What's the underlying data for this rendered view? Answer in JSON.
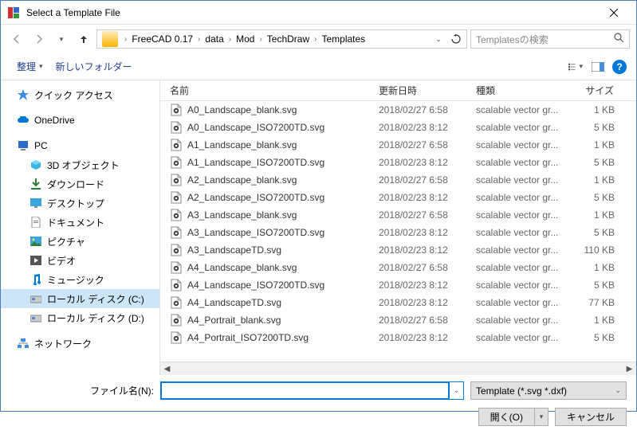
{
  "window": {
    "title": "Select a Template File"
  },
  "breadcrumbs": [
    "FreeCAD 0.17",
    "data",
    "Mod",
    "TechDraw",
    "Templates"
  ],
  "search": {
    "placeholder": "Templatesの検索"
  },
  "toolbar": {
    "organize": "整理",
    "newfolder": "新しいフォルダー"
  },
  "columns": {
    "name": "名前",
    "date": "更新日時",
    "type": "種類",
    "size": "サイズ"
  },
  "sidebar": {
    "quick": "クイック アクセス",
    "onedrive": "OneDrive",
    "pc": "PC",
    "objects3d": "3D オブジェクト",
    "downloads": "ダウンロード",
    "desktop": "デスクトップ",
    "documents": "ドキュメント",
    "pictures": "ピクチャ",
    "videos": "ビデオ",
    "music": "ミュージック",
    "diskc": "ローカル ディスク (C:)",
    "diskd": "ローカル ディスク (D:)",
    "network": "ネットワーク"
  },
  "files": [
    {
      "name": "A0_Landscape_blank.svg",
      "date": "2018/02/27 6:58",
      "type": "scalable vector gr...",
      "size": "1 KB"
    },
    {
      "name": "A0_Landscape_ISO7200TD.svg",
      "date": "2018/02/23 8:12",
      "type": "scalable vector gr...",
      "size": "5 KB"
    },
    {
      "name": "A1_Landscape_blank.svg",
      "date": "2018/02/27 6:58",
      "type": "scalable vector gr...",
      "size": "1 KB"
    },
    {
      "name": "A1_Landscape_ISO7200TD.svg",
      "date": "2018/02/23 8:12",
      "type": "scalable vector gr...",
      "size": "5 KB"
    },
    {
      "name": "A2_Landscape_blank.svg",
      "date": "2018/02/27 6:58",
      "type": "scalable vector gr...",
      "size": "1 KB"
    },
    {
      "name": "A2_Landscape_ISO7200TD.svg",
      "date": "2018/02/23 8:12",
      "type": "scalable vector gr...",
      "size": "5 KB"
    },
    {
      "name": "A3_Landscape_blank.svg",
      "date": "2018/02/27 6:58",
      "type": "scalable vector gr...",
      "size": "1 KB"
    },
    {
      "name": "A3_Landscape_ISO7200TD.svg",
      "date": "2018/02/23 8:12",
      "type": "scalable vector gr...",
      "size": "5 KB"
    },
    {
      "name": "A3_LandscapeTD.svg",
      "date": "2018/02/23 8:12",
      "type": "scalable vector gr...",
      "size": "110 KB"
    },
    {
      "name": "A4_Landscape_blank.svg",
      "date": "2018/02/27 6:58",
      "type": "scalable vector gr...",
      "size": "1 KB"
    },
    {
      "name": "A4_Landscape_ISO7200TD.svg",
      "date": "2018/02/23 8:12",
      "type": "scalable vector gr...",
      "size": "5 KB"
    },
    {
      "name": "A4_LandscapeTD.svg",
      "date": "2018/02/23 8:12",
      "type": "scalable vector gr...",
      "size": "77 KB"
    },
    {
      "name": "A4_Portrait_blank.svg",
      "date": "2018/02/27 6:58",
      "type": "scalable vector gr...",
      "size": "1 KB"
    },
    {
      "name": "A4_Portrait_ISO7200TD.svg",
      "date": "2018/02/23 8:12",
      "type": "scalable vector gr...",
      "size": "5 KB"
    }
  ],
  "footer": {
    "filename_label": "ファイル名(N):",
    "filetype": "Template (*.svg *.dxf)",
    "open": "開く(O)",
    "cancel": "キャンセル"
  }
}
